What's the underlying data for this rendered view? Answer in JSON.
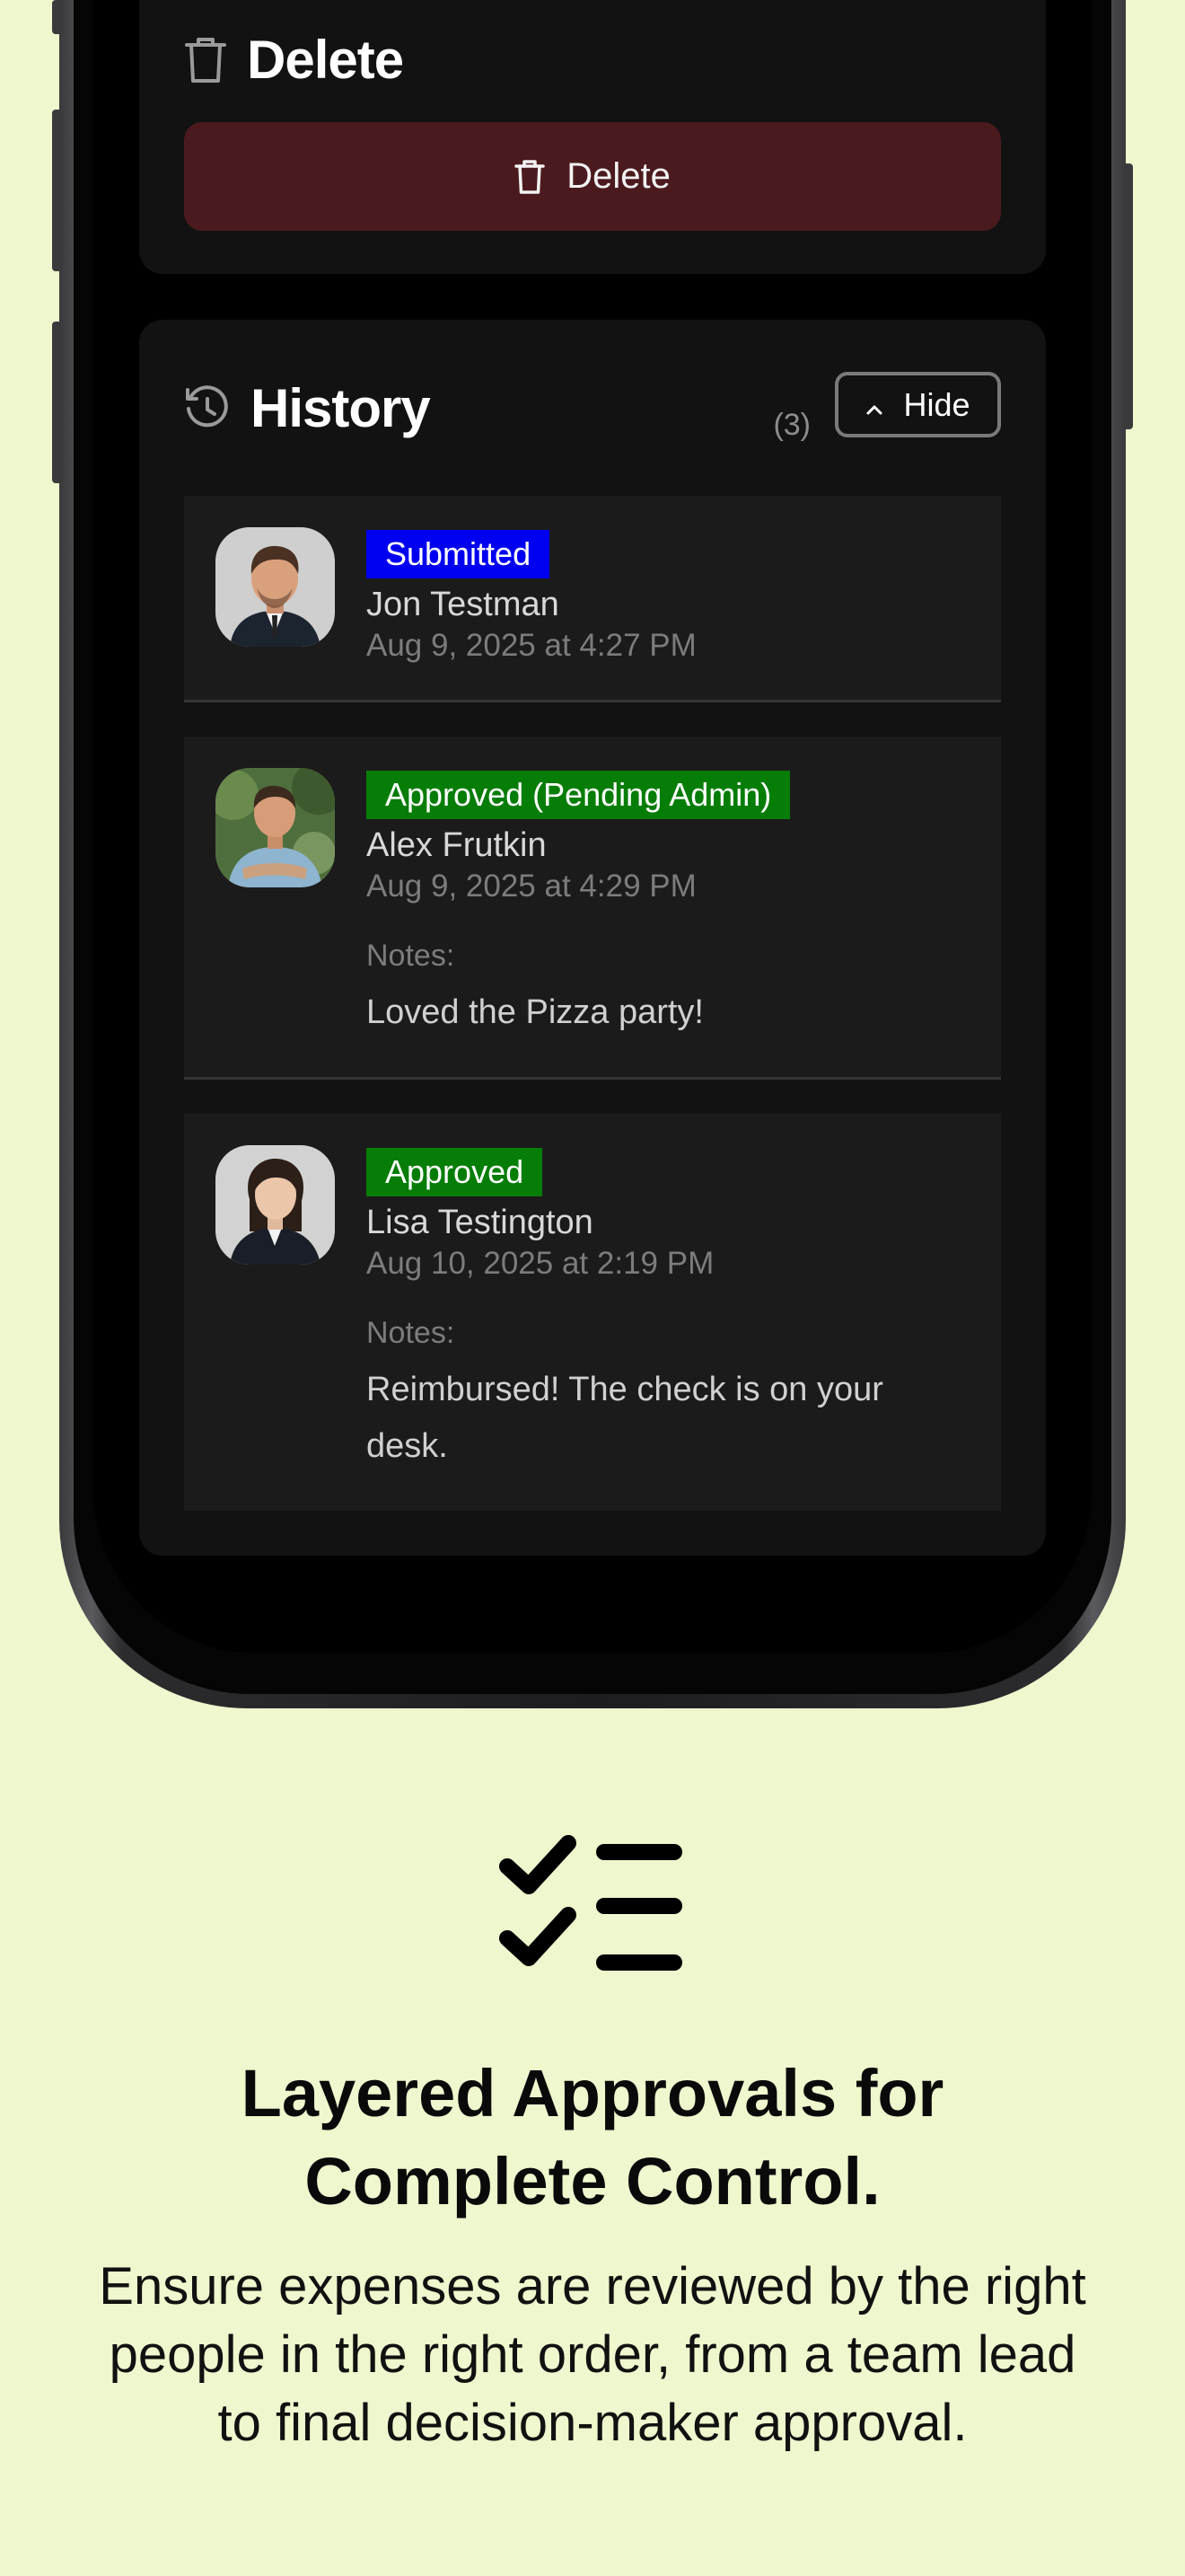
{
  "delete_section": {
    "title": "Delete",
    "button_label": "Delete",
    "button_color": "#4b1a1e"
  },
  "history": {
    "title": "History",
    "count": "(3)",
    "toggle_label": "Hide",
    "entries": [
      {
        "status": "Submitted",
        "status_color": "#0000f0",
        "name": "Jon Testman",
        "timestamp": "Aug 9, 2025 at 4:27 PM"
      },
      {
        "status": "Approved (Pending Admin)",
        "status_color": "#067d06",
        "name": "Alex Frutkin",
        "timestamp": "Aug 9, 2025 at 4:29 PM",
        "notes_label": "Notes:",
        "notes": "Loved the Pizza party!"
      },
      {
        "status": "Approved",
        "status_color": "#067d06",
        "name": "Lisa Testington",
        "timestamp": "Aug 10, 2025 at 2:19 PM",
        "notes_label": "Notes:",
        "notes": "Reimbursed! The check is on your desk."
      }
    ]
  },
  "marketing": {
    "icon": "checklist-icon",
    "headline_line1": "Layered Approvals for",
    "headline_line2": "Complete Control.",
    "body_line1": "Ensure expenses are reviewed by the right",
    "body_line2": "people in the right order, from a team lead",
    "body_line3": "to final decision-maker approval.",
    "background_color": "#eef7cd"
  }
}
